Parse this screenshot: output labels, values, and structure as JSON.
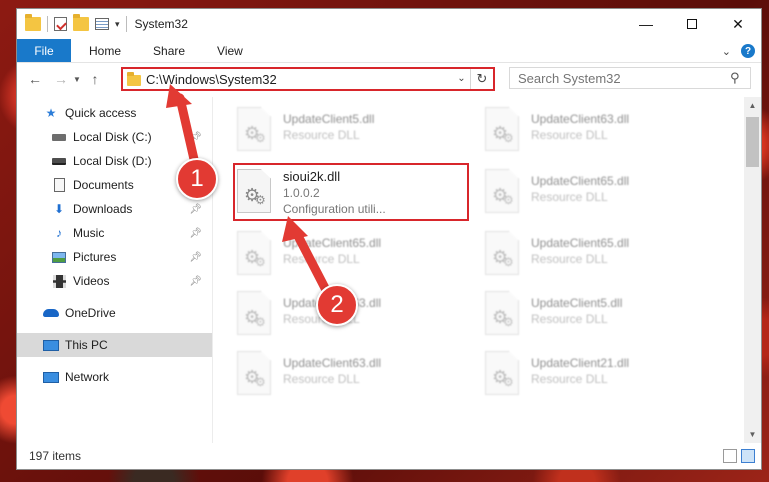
{
  "window": {
    "title": "System32"
  },
  "ribbon": {
    "tabs": [
      "File",
      "Home",
      "Share",
      "View"
    ]
  },
  "nav": {
    "address": "C:\\Windows\\System32",
    "search_placeholder": "Search System32"
  },
  "sidebar": {
    "items": [
      {
        "label": "Quick access",
        "icon": "star-icon",
        "pinned": false
      },
      {
        "label": "Local Disk (C:)",
        "icon": "drive-icon",
        "pinned": true
      },
      {
        "label": "Local Disk (D:)",
        "icon": "drive-icon",
        "pinned": false
      },
      {
        "label": "Documents",
        "icon": "documents-icon",
        "pinned": true
      },
      {
        "label": "Downloads",
        "icon": "downloads-icon",
        "pinned": true
      },
      {
        "label": "Music",
        "icon": "music-icon",
        "pinned": true
      },
      {
        "label": "Pictures",
        "icon": "pictures-icon",
        "pinned": true
      },
      {
        "label": "Videos",
        "icon": "videos-icon",
        "pinned": true
      },
      {
        "label": "OneDrive",
        "icon": "onedrive-icon",
        "pinned": false
      },
      {
        "label": "This PC",
        "icon": "this-pc-icon",
        "pinned": false,
        "selected": true
      },
      {
        "label": "Network",
        "icon": "network-icon",
        "pinned": false
      }
    ]
  },
  "files": [
    {
      "name": "UpdateClient5.dll",
      "type": "Resource DLL"
    },
    {
      "name": "UpdateClient63.dll",
      "type": "Resource DLL"
    },
    {
      "name": "sioui2k.dll",
      "version": "1.0.0.2",
      "type": "Configuration utili...",
      "highlighted": true
    },
    {
      "name": "UpdateClient65.dll",
      "type": "Resource DLL"
    },
    {
      "name": "UpdateClient65.dll",
      "type": "Resource DLL"
    },
    {
      "name": "UpdateClient65.dll",
      "type": "Resource DLL"
    },
    {
      "name": "UpdateClient63.dll",
      "type": "Resource DLL"
    },
    {
      "name": "UpdateClient5.dll",
      "type": "Resource DLL"
    },
    {
      "name": "UpdateClient63.dll",
      "type": "Resource DLL"
    },
    {
      "name": "UpdateClient21.dll",
      "type": "Resource DLL"
    }
  ],
  "status": {
    "item_count": "197 items"
  },
  "annotations": {
    "step1": "1",
    "step2": "2"
  },
  "colors": {
    "accent": "#1979ca",
    "highlight": "#d8262b",
    "badge": "#e23a33"
  }
}
